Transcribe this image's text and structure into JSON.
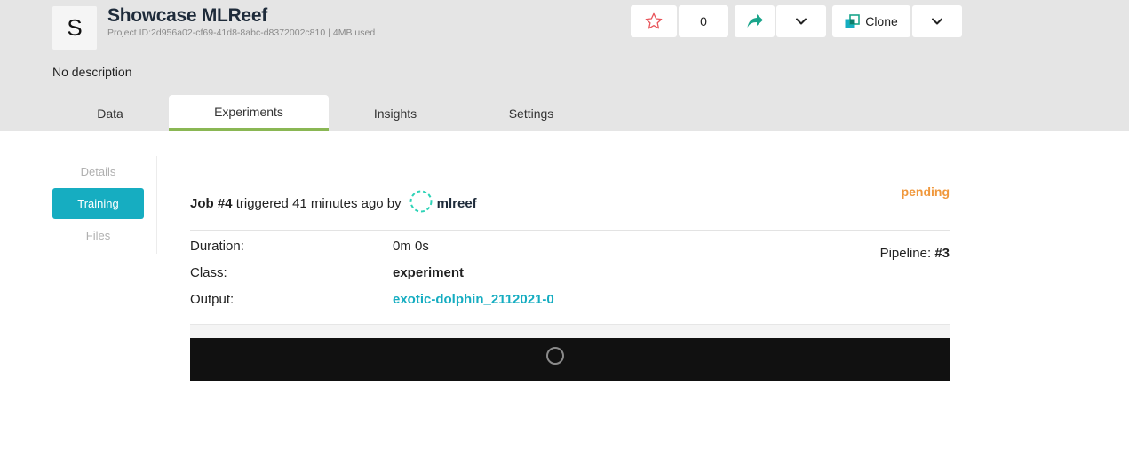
{
  "project": {
    "avatar_letter": "S",
    "title": "Showcase MLReef",
    "project_id_text": "Project ID:2d956a02-cf69-41d8-8abc-d8372002c810",
    "meta_separator": "|",
    "storage_text": "4MB used",
    "description": "No description"
  },
  "actions": {
    "star_icon": "star-outline-icon",
    "star_count": "0",
    "share_icon": "share-arrow-icon",
    "clone_label": "Clone",
    "clone_icon": "clone-squares-icon",
    "dropdown_icon": "chevron-down-icon"
  },
  "tabs": [
    {
      "label": "Data"
    },
    {
      "label": "Experiments"
    },
    {
      "label": "Insights"
    },
    {
      "label": "Settings"
    }
  ],
  "active_tab": "Experiments",
  "sidebar": {
    "items": [
      {
        "label": "Details"
      },
      {
        "label": "Training"
      },
      {
        "label": "Files"
      }
    ],
    "active": "Training"
  },
  "job": {
    "job_label": "Job #4",
    "triggered_text": " triggered 41 minutes ago by",
    "user": "mlreef",
    "status": "pending",
    "duration_label": "Duration:",
    "duration_value": "0m 0s",
    "class_label": "Class:",
    "class_value": "experiment",
    "output_label": "Output:",
    "output_value": "exotic-dolphin_2112021-0",
    "pipeline_label": "Pipeline:",
    "pipeline_value": "#3"
  },
  "colors": {
    "accent": "#16adc1",
    "tab_underline": "#8ab754",
    "status_pending": "#f0983c",
    "header_bg": "#e5e5e5",
    "share_green": "#1aa58b"
  }
}
